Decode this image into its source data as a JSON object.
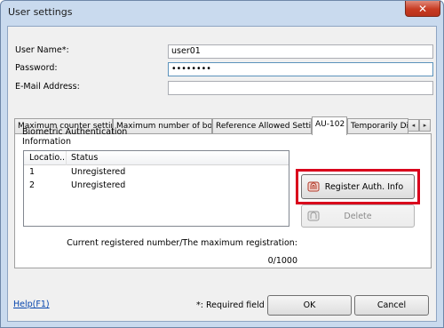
{
  "window": {
    "title": "User settings",
    "close_glyph": "✕"
  },
  "fields": {
    "username_label": "User Name*:",
    "username_value": "user01",
    "password_label": "Password:",
    "password_value": "••••••••",
    "email_label": "E-Mail Address:",
    "email_value": ""
  },
  "tabs": [
    {
      "label": "Maximum counter settings"
    },
    {
      "label": "Maximum number of boxes"
    },
    {
      "label": "Reference Allowed Setting"
    },
    {
      "label": "AU-102"
    },
    {
      "label": "Temporarily Disa"
    }
  ],
  "tab_scroll": {
    "left": "◂",
    "right": "▸"
  },
  "panel": {
    "group_label_line1": "Biometric Authentication",
    "group_label_line2": "Information",
    "list": {
      "columns": [
        "Locatio...",
        "Status"
      ],
      "rows": [
        {
          "location": "1",
          "status": "Unregistered"
        },
        {
          "location": "2",
          "status": "Unregistered"
        }
      ]
    },
    "register_button": "Register Auth. Info",
    "delete_button": "Delete",
    "registered_caption": "Current registered number/The maximum registration:",
    "registered_count": "0/1000",
    "highlight_color": "#d9001c"
  },
  "footer": {
    "help_link": "Help(F1)",
    "required_note": "*: Required field",
    "ok_button": "OK",
    "cancel_button": "Cancel"
  }
}
